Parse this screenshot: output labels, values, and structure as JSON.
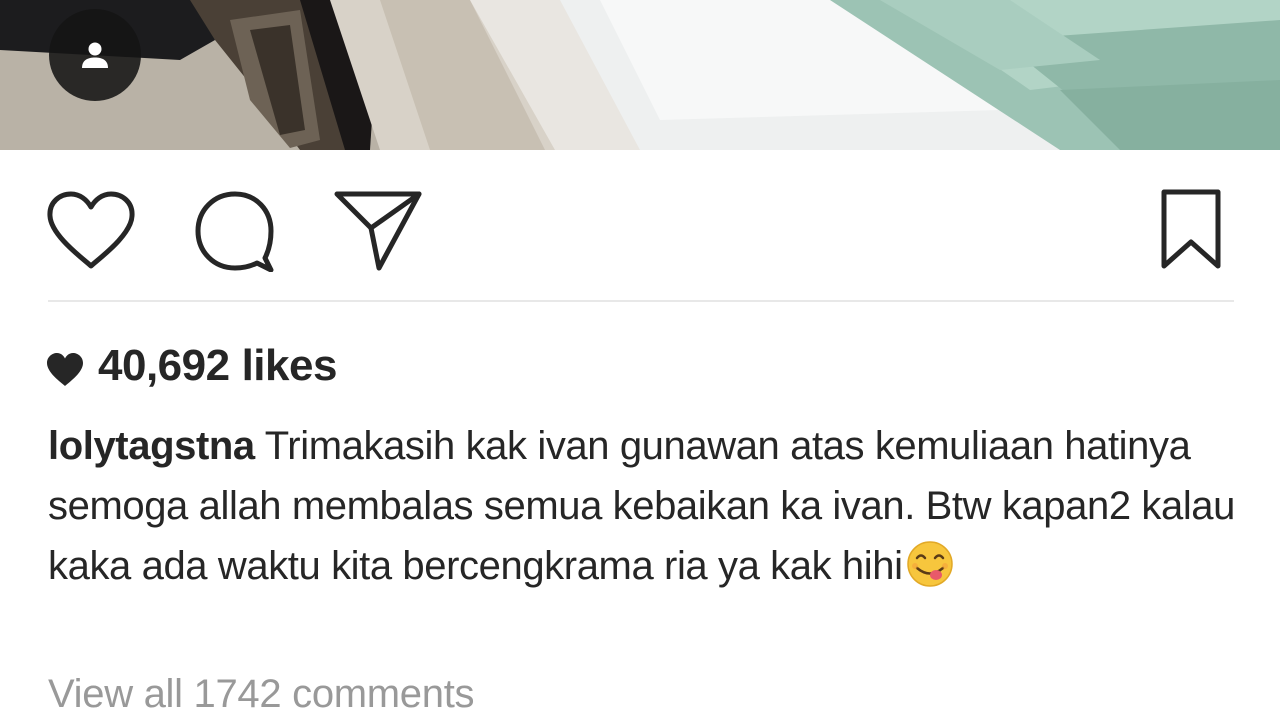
{
  "post": {
    "photo": {
      "alt_icon": "user-tag-icon"
    },
    "actions": {
      "like_icon": "heart-outline-icon",
      "comment_icon": "comment-bubble-icon",
      "share_icon": "paper-plane-icon",
      "save_icon": "bookmark-icon"
    },
    "likes": {
      "icon": "heart-filled-icon",
      "count": "40,692",
      "suffix": "likes"
    },
    "caption": {
      "username": "lolytagstna",
      "text": " Trimakasih kak ivan gunawan atas kemuliaan hatinya semoga allah membalas semua kebaikan ka ivan. Btw kapan2 kalau kaka ada waktu kita bercengkrama ria ya kak hihi",
      "emoji": "smiling-face-savoring-food-emoji"
    },
    "comments": {
      "view_all_label": "View all 1742 comments"
    }
  },
  "colors": {
    "text": "#262626",
    "muted": "#999999",
    "icon_stroke": "#262626",
    "divider": "#e8e8e8"
  }
}
